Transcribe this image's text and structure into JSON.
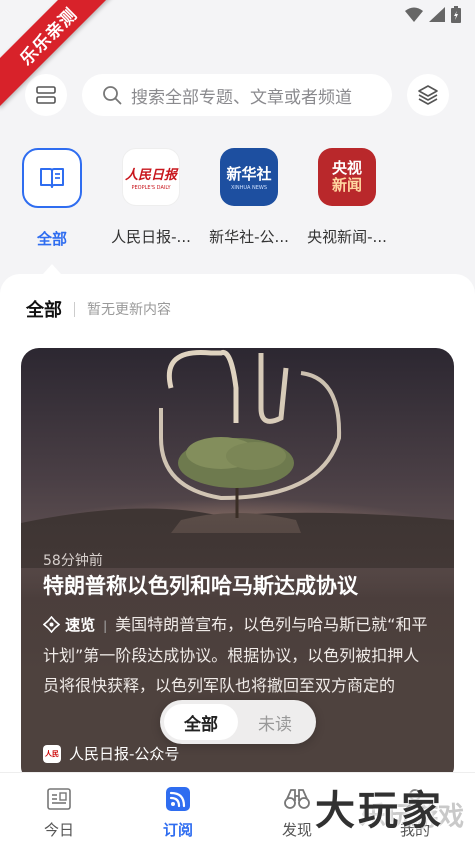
{
  "ribbon": {
    "text": "乐乐亲测"
  },
  "search": {
    "placeholder": "搜索全部专题、文章或者频道"
  },
  "channels": [
    {
      "label": "全部",
      "active": true
    },
    {
      "label": "人民日报-...",
      "logo_text": "人民日报",
      "logo_sub": "PEOPLE'S DAILY"
    },
    {
      "label": "新华社-公...",
      "logo_text": "新华社",
      "logo_sub": "XINHUA NEWS"
    },
    {
      "label": "央视新闻-...",
      "logo_text_1": "央视",
      "logo_text_2": "新闻"
    }
  ],
  "feed": {
    "title": "全部",
    "subtitle": "暂无更新内容"
  },
  "article": {
    "time": "58分钟前",
    "headline": "特朗普称以色列和哈马斯达成协议",
    "tag": "速览",
    "summary": "美国特朗普宣布，以色列与哈马斯已就“和平计划”第一阶段达成协议。根据协议，以色列被扣押人员将很快获释，以色列军队也将撤回至双方商定的",
    "source": "人民日报-公众号"
  },
  "toggle": {
    "all": "全部",
    "unread": "未读"
  },
  "nav": [
    {
      "label": "今日",
      "icon": "newspaper-icon"
    },
    {
      "label": "订阅",
      "icon": "rss-icon",
      "active": true
    },
    {
      "label": "发现",
      "icon": "binoculars-icon"
    },
    {
      "label": "我的",
      "icon": "user-icon"
    }
  ],
  "watermark": {
    "text": "大玩家",
    "faint": "乐玩游戏"
  },
  "colors": {
    "accent": "#2f6df0",
    "ribbon": "#d8222a",
    "xinhua": "#1d4fa0",
    "cctv": "#b9282b"
  }
}
